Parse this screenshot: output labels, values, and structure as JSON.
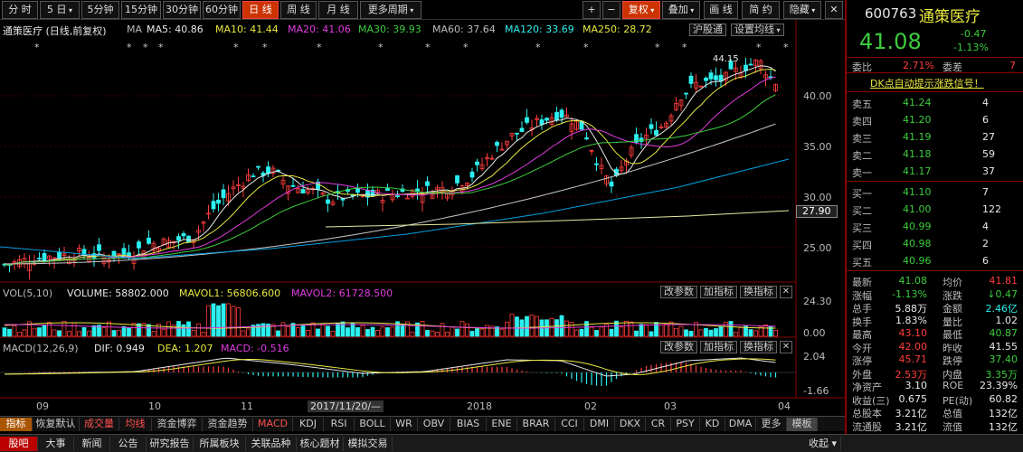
{
  "toolbar": {
    "periods": [
      "分 时",
      "5 日",
      "5分钟",
      "15分钟",
      "30分钟",
      "60分钟",
      "日 线",
      "周 线",
      "月 线",
      "更多周期"
    ],
    "plus": "+",
    "minus": "−",
    "fq": "复权",
    "overlay": "叠加",
    "draw": "画 线",
    "simple": "简 约",
    "hide": "隐藏",
    "close": "✕"
  },
  "chart_header": {
    "title": "通策医疗 (日线,前复权)",
    "ma_label": "MA",
    "ma5": "MA5: 40.86",
    "ma10": "MA10: 41.44",
    "ma20": "MA20: 41.06",
    "ma30": "MA30: 39.93",
    "ma60": "MA60: 37.64",
    "ma120": "MA120: 33.69",
    "ma250": "MA250: 28.72",
    "btn_hgt": "沪股通",
    "btn_setma": "设置均线"
  },
  "colors": {
    "up": "#ff3c3c",
    "down": "#2cf0f0",
    "ma5": "#e8e8e8",
    "ma10": "#e8e840",
    "ma20": "#e03ce0",
    "ma30": "#3ccc3c",
    "ma60": "#c8c8c8",
    "ma120": "#00a0e0",
    "ma250": "#e8e8a0"
  },
  "price_axis": {
    "ticks": [
      "40.00",
      "35.00",
      "30.00",
      "25.00"
    ],
    "current": "27.90",
    "peak_label": "44.15"
  },
  "volume_header": {
    "name": "VOL(5,10)",
    "volume": "VOLUME: 58802.000",
    "mavol1": "MAVOL1: 56806.600",
    "mavol2": "MAVOL2: 61728.500",
    "ticks": [
      "24.30",
      "0.00"
    ]
  },
  "macd_header": {
    "name": "MACD(12,26,9)",
    "dif": "DIF: 0.949",
    "dea": "DEA: 1.207",
    "macd": "MACD: -0.516",
    "ticks": [
      "2.04",
      "-1.66"
    ]
  },
  "panel_buttons": {
    "change_param": "改参数",
    "add_ind": "加指标",
    "swap_ind": "换指标"
  },
  "x_axis": {
    "labels": [
      "09",
      "10",
      "11",
      "2017/11/20/—",
      "2018",
      "02",
      "03",
      "04"
    ]
  },
  "indicator_tabs": [
    "指标",
    "恢复默认",
    "成交量",
    "均线",
    "资金博弈",
    "资金趋势",
    "MACD",
    "KDJ",
    "RSI",
    "BOLL",
    "WR",
    "OBV",
    "BIAS",
    "ENE",
    "BRAR",
    "CCI",
    "DMI",
    "DKX",
    "CR",
    "PSY",
    "KD",
    "DMA",
    "更多",
    "模板"
  ],
  "bottom_tabs": [
    "股吧",
    "大事",
    "新闻",
    "公告",
    "研究报告",
    "所属板块",
    "关联品种",
    "核心题材",
    "模拟交易"
  ],
  "bottom_right": "收起",
  "quote": {
    "code": "600763",
    "name": "通策医疗",
    "price": "41.08",
    "change": "-0.47",
    "change_pct": "-1.13%",
    "weibi_label": "委比",
    "weibi": "2.71%",
    "weicha_label": "委差",
    "weicha": "7",
    "dk_banner": "DK点自动提示涨跌信号！",
    "sell": [
      {
        "label": "卖五",
        "price": "41.24",
        "vol": "4"
      },
      {
        "label": "卖四",
        "price": "41.20",
        "vol": "6"
      },
      {
        "label": "卖三",
        "price": "41.19",
        "vol": "27"
      },
      {
        "label": "卖二",
        "price": "41.18",
        "vol": "59"
      },
      {
        "label": "卖一",
        "price": "41.17",
        "vol": "37"
      }
    ],
    "buy": [
      {
        "label": "买一",
        "price": "41.10",
        "vol": "7"
      },
      {
        "label": "买二",
        "price": "41.00",
        "vol": "122"
      },
      {
        "label": "买三",
        "price": "40.99",
        "vol": "4"
      },
      {
        "label": "买四",
        "price": "40.98",
        "vol": "2"
      },
      {
        "label": "买五",
        "price": "40.96",
        "vol": "6"
      }
    ],
    "stats": [
      {
        "l1": "最新",
        "v1": "41.08",
        "c1": "grn",
        "l2": "均价",
        "v2": "41.81",
        "c2": "red"
      },
      {
        "l1": "涨幅",
        "v1": "-1.13%",
        "c1": "grn",
        "l2": "涨跌",
        "v2": "↓0.47",
        "c2": "grn"
      },
      {
        "l1": "总手",
        "v1": "5.88万",
        "c1": "wht",
        "l2": "金额",
        "v2": "2.46亿",
        "c2": "cyan"
      },
      {
        "l1": "换手",
        "v1": "1.83%",
        "c1": "wht",
        "l2": "量比",
        "v2": "1.02",
        "c2": "wht"
      },
      {
        "l1": "最高",
        "v1": "43.10",
        "c1": "red",
        "l2": "最低",
        "v2": "40.87",
        "c2": "grn"
      },
      {
        "l1": "今开",
        "v1": "42.00",
        "c1": "red",
        "l2": "昨收",
        "v2": "41.55",
        "c2": "wht"
      },
      {
        "l1": "涨停",
        "v1": "45.71",
        "c1": "red",
        "l2": "跌停",
        "v2": "37.40",
        "c2": "grn"
      },
      {
        "l1": "外盘",
        "v1": "2.53万",
        "c1": "red",
        "l2": "内盘",
        "v2": "3.35万",
        "c2": "grn"
      },
      {
        "l1": "净资产",
        "v1": "3.10",
        "c1": "wht",
        "l2": "ROE",
        "v2": "23.39%",
        "c2": "wht"
      },
      {
        "l1": "收益(三)",
        "v1": "0.675",
        "c1": "wht",
        "l2": "PE(动)",
        "v2": "60.82",
        "c2": "wht"
      },
      {
        "l1": "总股本",
        "v1": "3.21亿",
        "c1": "wht",
        "l2": "总值",
        "v2": "132亿",
        "c2": "wht"
      },
      {
        "l1": "流通股",
        "v1": "3.21亿",
        "c1": "wht",
        "l2": "流值",
        "v2": "132亿",
        "c2": "wht"
      }
    ]
  }
}
